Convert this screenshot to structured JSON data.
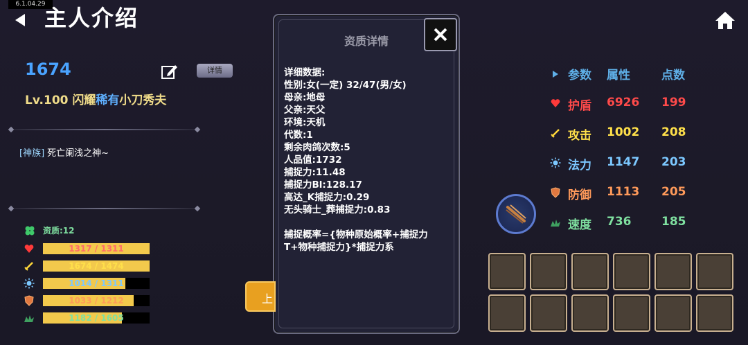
{
  "app": {
    "version": "6.1.04.29",
    "title": "主人介绍"
  },
  "player": {
    "id": "1674",
    "detail_label": "详情",
    "name_prefix": "Lv.100 闪耀",
    "name_rare": "稀有",
    "name_suffix": "小刀秀夫",
    "tribe_tag": "[神族]",
    "tribe_text": "死亡阑浅之神~"
  },
  "left_stats": {
    "quality_label": "资质:12",
    "bars": [
      {
        "label": "1317 / 1311",
        "fill": 1.0,
        "color": "#ff6a6a",
        "icon": "heart-icon"
      },
      {
        "label": "1674 / 1474",
        "fill": 1.0,
        "color": "#ffe04a",
        "icon": "sword-icon"
      },
      {
        "label": "1014 / 1311",
        "fill": 0.77,
        "color": "#7cc8ff",
        "icon": "sun-icon"
      },
      {
        "label": "1033 / 1212",
        "fill": 0.85,
        "color": "#ff9a5a",
        "icon": "shield-icon"
      },
      {
        "label": "1182 / 1605",
        "fill": 0.74,
        "color": "#7fe0a0",
        "icon": "leaf-icon"
      }
    ]
  },
  "modal": {
    "title": "资质详情",
    "lines": [
      "详细数据:",
      "性别:女(一定)  32/47(男/女)",
      "母亲:地母",
      "父亲:天父",
      "环境:天机",
      "代数:1",
      "剩余肉鸽次数:5",
      "人品值:1732",
      "捕捉力:11.48",
      "捕捉力Bl:128.17",
      "高达_K捕捉力:0.29",
      "无头骑士_葬捕捉力:0.83",
      "",
      "捕捉概率={物种原始概率+捕捉力",
      "T+物种捕捉力}*捕捉力系"
    ]
  },
  "side_button": {
    "label": "上"
  },
  "right_stats": {
    "headers": {
      "param": "参数",
      "attr": "属性",
      "points": "点数"
    },
    "rows": [
      {
        "name": "护盾",
        "attr": "6926",
        "points": "199",
        "color": "#ff4a4a",
        "icon": "heart-icon"
      },
      {
        "name": "攻击",
        "attr": "1002",
        "points": "208",
        "color": "#ffe04a",
        "icon": "sword-icon"
      },
      {
        "name": "法力",
        "attr": "1147",
        "points": "203",
        "color": "#7cc8ff",
        "icon": "sun-icon"
      },
      {
        "name": "防御",
        "attr": "1113",
        "points": "205",
        "color": "#ff9a5a",
        "icon": "shield-icon"
      },
      {
        "name": "速度",
        "attr": "736",
        "points": "185",
        "color": "#7fe0a0",
        "icon": "leaf-icon"
      }
    ]
  },
  "colors": {
    "accent_blue": "#4aa3ff",
    "header_blue": "#5fb0e8"
  }
}
